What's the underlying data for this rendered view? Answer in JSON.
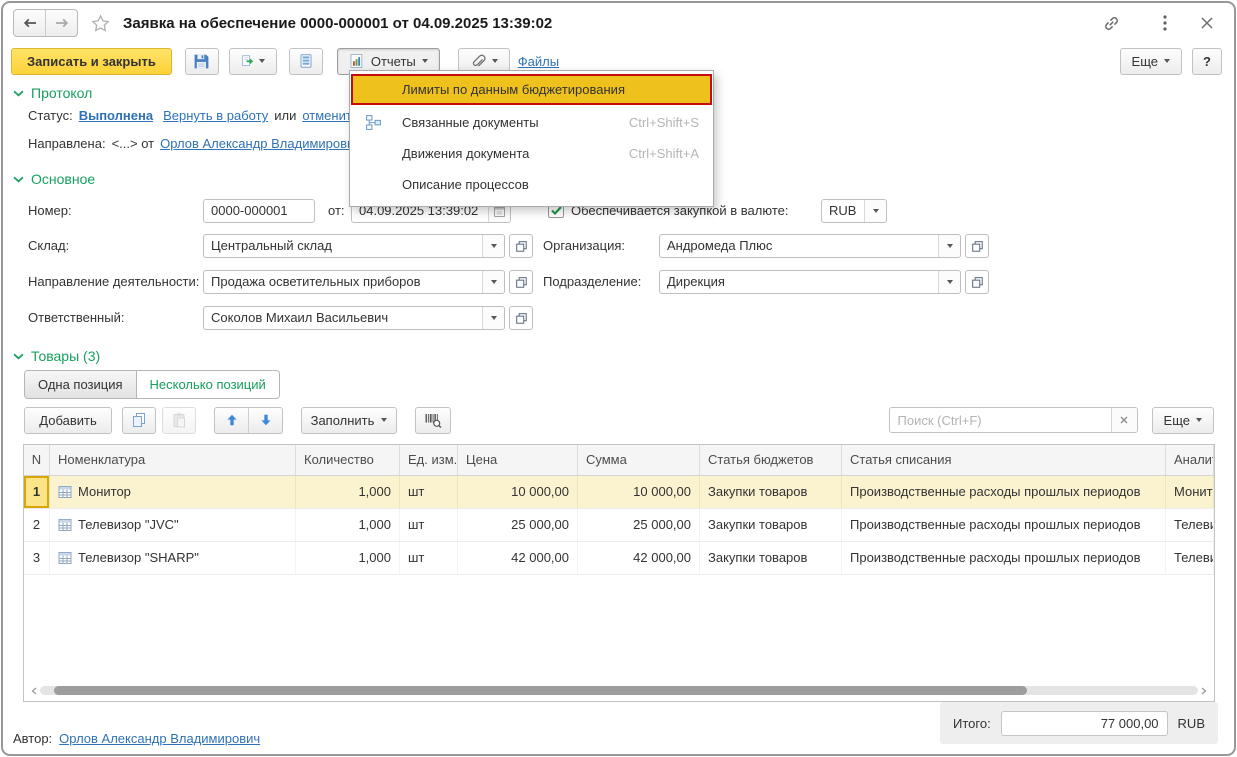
{
  "window": {
    "title": "Заявка на обеспечение 0000-000001 от 04.09.2025 13:39:02"
  },
  "commandbar": {
    "save_and_close": "Записать и закрыть",
    "reports_label": "Отчеты",
    "files_label": "Файлы",
    "more_label": "Еще",
    "help_label": "?"
  },
  "reports_menu": {
    "items": [
      {
        "label": "Лимиты по данным бюджетирования",
        "highlighted": true
      },
      {
        "label": "Связанные документы",
        "shortcut": "Ctrl+Shift+S",
        "icon": "linked-documents"
      },
      {
        "label": "Движения документа",
        "shortcut": "Ctrl+Shift+A"
      },
      {
        "label": "Описание процессов"
      }
    ]
  },
  "protocol": {
    "title": "Протокол",
    "status_label": "Статус:",
    "status_value": "Выполнена",
    "return_link": "Вернуть в работу",
    "or_text": "или",
    "cancel_link": "отменить",
    "sent_label": "Направлена:",
    "sent_value": "<...> от",
    "sent_author": "Орлов Александр Владимирович"
  },
  "main": {
    "title": "Основное",
    "number_label": "Номер:",
    "number": "0000-000001",
    "date_label": "от:",
    "date": "04.09.2025 13:39:02",
    "currency_checkbox_label": "Обеспечивается закупкой в валюте:",
    "currency": "RUB",
    "warehouse_label": "Склад:",
    "warehouse": "Центральный склад",
    "org_label": "Организация:",
    "org": "Андромеда Плюс",
    "activity_label": "Направление деятельности:",
    "activity": "Продажа осветительных приборов",
    "department_label": "Подразделение:",
    "department": "Дирекция",
    "responsible_label": "Ответственный:",
    "responsible": "Соколов Михаил Васильевич"
  },
  "goods": {
    "title": "Товары (3)",
    "tab_one": "Одна позиция",
    "tab_many": "Несколько позиций",
    "add_label": "Добавить",
    "fill_label": "Заполнить",
    "search_placeholder": "Поиск (Ctrl+F)",
    "more_label": "Еще",
    "columns": [
      "N",
      "Номенклатура",
      "Количество",
      "Ед. изм.",
      "Цена",
      "Сумма",
      "Статья бюджетов",
      "Статья списания",
      "Аналитика"
    ],
    "rows": [
      {
        "n": "1",
        "name": "Монитор",
        "qty": "1,000",
        "unit": "шт",
        "price": "10 000,00",
        "sum": "10 000,00",
        "budget": "Закупки товаров",
        "writeoff": "Производственные расходы прошлых периодов",
        "analytics": "Монитор"
      },
      {
        "n": "2",
        "name": "Телевизор \"JVC\"",
        "qty": "1,000",
        "unit": "шт",
        "price": "25 000,00",
        "sum": "25 000,00",
        "budget": "Закупки товаров",
        "writeoff": "Производственные расходы прошлых периодов",
        "analytics": "Телевизор \"JVC\""
      },
      {
        "n": "3",
        "name": "Телевизор \"SHARP\"",
        "qty": "1,000",
        "unit": "шт",
        "price": "42 000,00",
        "sum": "42 000,00",
        "budget": "Закупки товаров",
        "writeoff": "Производственные расходы прошлых периодов",
        "analytics": "Телевизор \"SHARP\""
      }
    ]
  },
  "footer": {
    "author_label": "Автор:",
    "author": "Орлов Александр Владимирович",
    "total_label": "Итого:",
    "total": "77 000,00",
    "total_currency": "RUB"
  },
  "colors": {
    "accent_green": "#17a05e",
    "link_blue": "#2f72b6",
    "primary_button_yellow": "#ffd73e",
    "menu_highlight_yellow": "#eec11c",
    "menu_highlight_border_red": "#c70b0b",
    "selected_row_yellow": "#fbf3cf"
  }
}
